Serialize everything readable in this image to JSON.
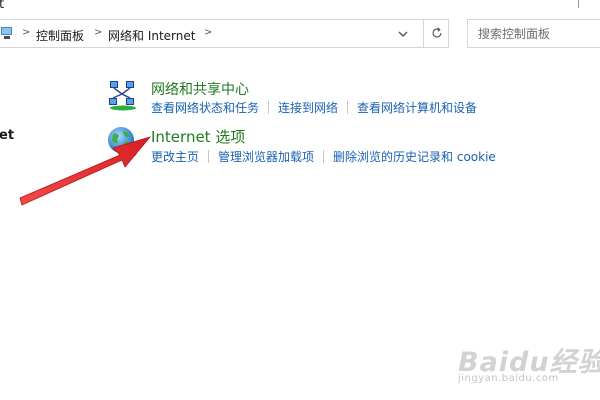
{
  "window": {
    "title_fragment": "t"
  },
  "address_bar": {
    "breadcrumbs": [
      {
        "label": "控制面板"
      },
      {
        "label": "网络和 Internet"
      }
    ]
  },
  "search": {
    "placeholder": "搜索控制面板"
  },
  "left_nav": {
    "fragment": "et"
  },
  "categories": [
    {
      "title": "网络和共享中心",
      "icon": "network-sharing-center-icon",
      "links": [
        "查看网络状态和任务",
        "连接到网络",
        "查看网络计算机和设备"
      ]
    },
    {
      "title": "Internet 选项",
      "icon": "internet-globe-icon",
      "links": [
        "更改主页",
        "管理浏览器加载项",
        "删除浏览的历史记录和 cookie"
      ]
    }
  ],
  "annotation": {
    "arrow_color": "#e0262a"
  },
  "watermark": {
    "brand": "Baidu经验",
    "url": "jingyan.baidu.com"
  },
  "colors": {
    "category_title": "#1f7b1f",
    "link": "#1a62b3"
  }
}
